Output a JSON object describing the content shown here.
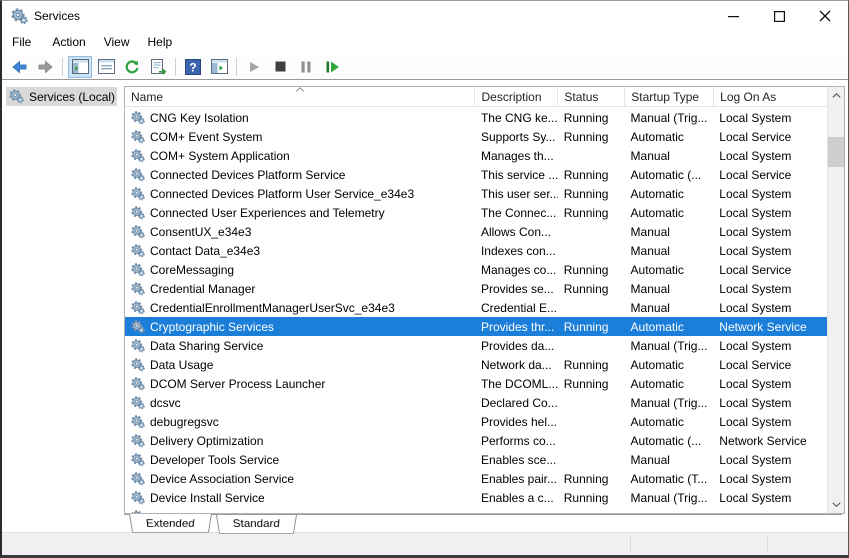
{
  "window": {
    "title": "Services"
  },
  "menu": {
    "items": [
      "File",
      "Action",
      "View",
      "Help"
    ]
  },
  "toolbar": {
    "buttons": [
      "back",
      "forward",
      "show-hide-console-tree",
      "properties",
      "refresh",
      "export-list",
      "help",
      "show-hide-action-pane",
      "start-service",
      "stop-service",
      "pause-service",
      "restart-service"
    ],
    "active_button": "show-hide-console-tree",
    "help_glyph": "?"
  },
  "sidebar": {
    "root_label": "Services (Local)"
  },
  "table": {
    "columns": [
      "Name",
      "Description",
      "Status",
      "Startup Type",
      "Log On As"
    ],
    "sort_column": "Name",
    "sort_direction": "ascending",
    "selected_index": 11,
    "partial_row_visible": true,
    "rows": [
      {
        "name": "CNG Key Isolation",
        "description": "The CNG ke...",
        "status": "Running",
        "startup_type": "Manual (Trig...",
        "log_on_as": "Local System"
      },
      {
        "name": "COM+ Event System",
        "description": "Supports Sy...",
        "status": "Running",
        "startup_type": "Automatic",
        "log_on_as": "Local Service"
      },
      {
        "name": "COM+ System Application",
        "description": "Manages th...",
        "status": "",
        "startup_type": "Manual",
        "log_on_as": "Local System"
      },
      {
        "name": "Connected Devices Platform Service",
        "description": "This service ...",
        "status": "Running",
        "startup_type": "Automatic (...",
        "log_on_as": "Local Service"
      },
      {
        "name": "Connected Devices Platform User Service_e34e3",
        "description": "This user ser...",
        "status": "Running",
        "startup_type": "Automatic",
        "log_on_as": "Local System"
      },
      {
        "name": "Connected User Experiences and Telemetry",
        "description": "The Connec...",
        "status": "Running",
        "startup_type": "Automatic",
        "log_on_as": "Local System"
      },
      {
        "name": "ConsentUX_e34e3",
        "description": "Allows Con...",
        "status": "",
        "startup_type": "Manual",
        "log_on_as": "Local System"
      },
      {
        "name": "Contact Data_e34e3",
        "description": "Indexes con...",
        "status": "",
        "startup_type": "Manual",
        "log_on_as": "Local System"
      },
      {
        "name": "CoreMessaging",
        "description": "Manages co...",
        "status": "Running",
        "startup_type": "Automatic",
        "log_on_as": "Local Service"
      },
      {
        "name": "Credential Manager",
        "description": "Provides se...",
        "status": "Running",
        "startup_type": "Manual",
        "log_on_as": "Local System"
      },
      {
        "name": "CredentialEnrollmentManagerUserSvc_e34e3",
        "description": "Credential E...",
        "status": "",
        "startup_type": "Manual",
        "log_on_as": "Local System"
      },
      {
        "name": "Cryptographic Services",
        "description": "Provides thr...",
        "status": "Running",
        "startup_type": "Automatic",
        "log_on_as": "Network Service"
      },
      {
        "name": "Data Sharing Service",
        "description": "Provides da...",
        "status": "",
        "startup_type": "Manual (Trig...",
        "log_on_as": "Local System"
      },
      {
        "name": "Data Usage",
        "description": "Network da...",
        "status": "Running",
        "startup_type": "Automatic",
        "log_on_as": "Local Service"
      },
      {
        "name": "DCOM Server Process Launcher",
        "description": "The DCOML...",
        "status": "Running",
        "startup_type": "Automatic",
        "log_on_as": "Local System"
      },
      {
        "name": "dcsvc",
        "description": "Declared Co...",
        "status": "",
        "startup_type": "Manual (Trig...",
        "log_on_as": "Local System"
      },
      {
        "name": "debugregsvc",
        "description": "Provides hel...",
        "status": "",
        "startup_type": "Automatic",
        "log_on_as": "Local System"
      },
      {
        "name": "Delivery Optimization",
        "description": "Performs co...",
        "status": "",
        "startup_type": "Automatic (...",
        "log_on_as": "Network Service"
      },
      {
        "name": "Developer Tools Service",
        "description": "Enables sce...",
        "status": "",
        "startup_type": "Manual",
        "log_on_as": "Local System"
      },
      {
        "name": "Device Association Service",
        "description": "Enables pair...",
        "status": "Running",
        "startup_type": "Automatic (T...",
        "log_on_as": "Local System"
      },
      {
        "name": "Device Install Service",
        "description": "Enables a c...",
        "status": "Running",
        "startup_type": "Manual (Trig...",
        "log_on_as": "Local System"
      }
    ]
  },
  "tabs": {
    "items": [
      "Extended",
      "Standard"
    ],
    "active": "Extended"
  },
  "colors": {
    "selection_background": "#1b7ed9",
    "selection_text": "#ffffff",
    "toolbar_button_highlight": "#cde4f7",
    "tree_selection_background": "#d9d9d9",
    "status_bar_background": "#f0f0f0"
  }
}
